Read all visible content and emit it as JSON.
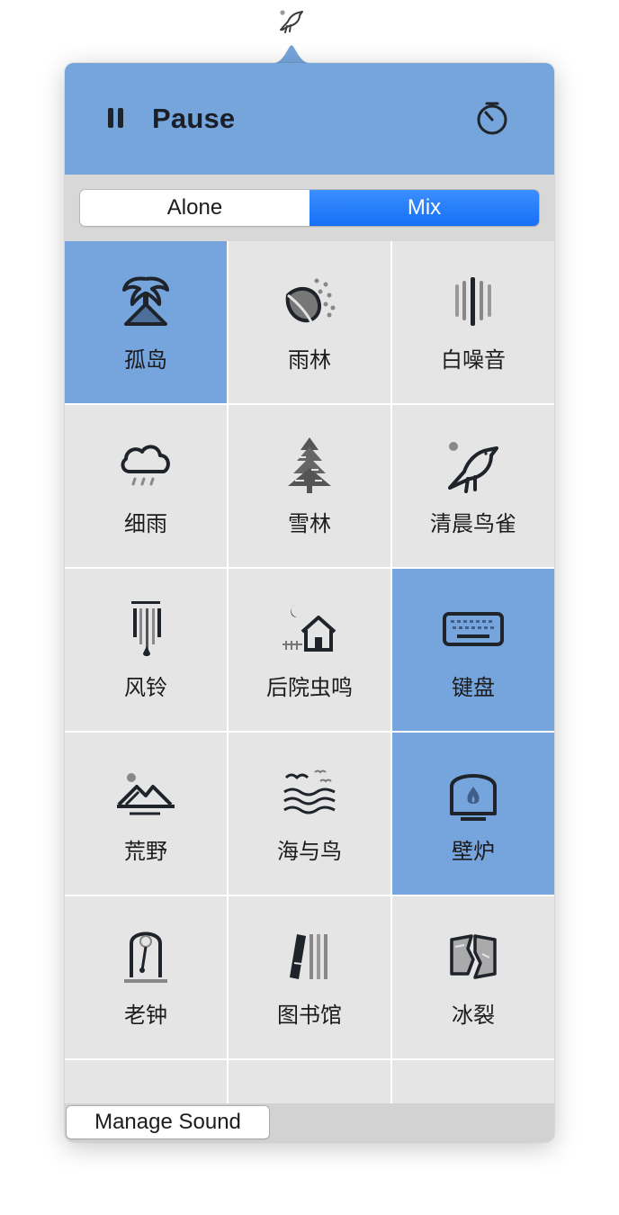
{
  "menubar": {
    "icon": "bird-icon"
  },
  "header": {
    "pause_icon": "pause-icon",
    "pause_label": "Pause",
    "timer_icon": "timer-icon"
  },
  "mode": {
    "options": [
      "Alone",
      "Mix"
    ],
    "selected": "Mix"
  },
  "sounds": [
    {
      "label": "孤岛",
      "icon": "island-icon",
      "active": true
    },
    {
      "label": "雨林",
      "icon": "rainforest-leaf-icon",
      "active": false
    },
    {
      "label": "白噪音",
      "icon": "white-noise-icon",
      "active": false
    },
    {
      "label": "细雨",
      "icon": "cloud-rain-icon",
      "active": false
    },
    {
      "label": "雪林",
      "icon": "snow-tree-icon",
      "active": false
    },
    {
      "label": "清晨鸟雀",
      "icon": "bird-icon",
      "active": false
    },
    {
      "label": "风铃",
      "icon": "wind-chime-icon",
      "active": false
    },
    {
      "label": "后院虫鸣",
      "icon": "house-moon-icon",
      "active": false
    },
    {
      "label": "键盘",
      "icon": "keyboard-icon",
      "active": true
    },
    {
      "label": "荒野",
      "icon": "mountains-icon",
      "active": false
    },
    {
      "label": "海与鸟",
      "icon": "sea-birds-icon",
      "active": false
    },
    {
      "label": "壁炉",
      "icon": "fireplace-icon",
      "active": true
    },
    {
      "label": "老钟",
      "icon": "pendulum-clock-icon",
      "active": false
    },
    {
      "label": "图书馆",
      "icon": "library-books-icon",
      "active": false
    },
    {
      "label": "冰裂",
      "icon": "ice-crack-icon",
      "active": false
    }
  ],
  "footer": {
    "manage_label": "Manage Sound"
  },
  "colors": {
    "header": "#76a5dc",
    "tile": "#e5e5e5",
    "tile_active": "#76a4dc",
    "mix_selected": "#1670f6"
  }
}
